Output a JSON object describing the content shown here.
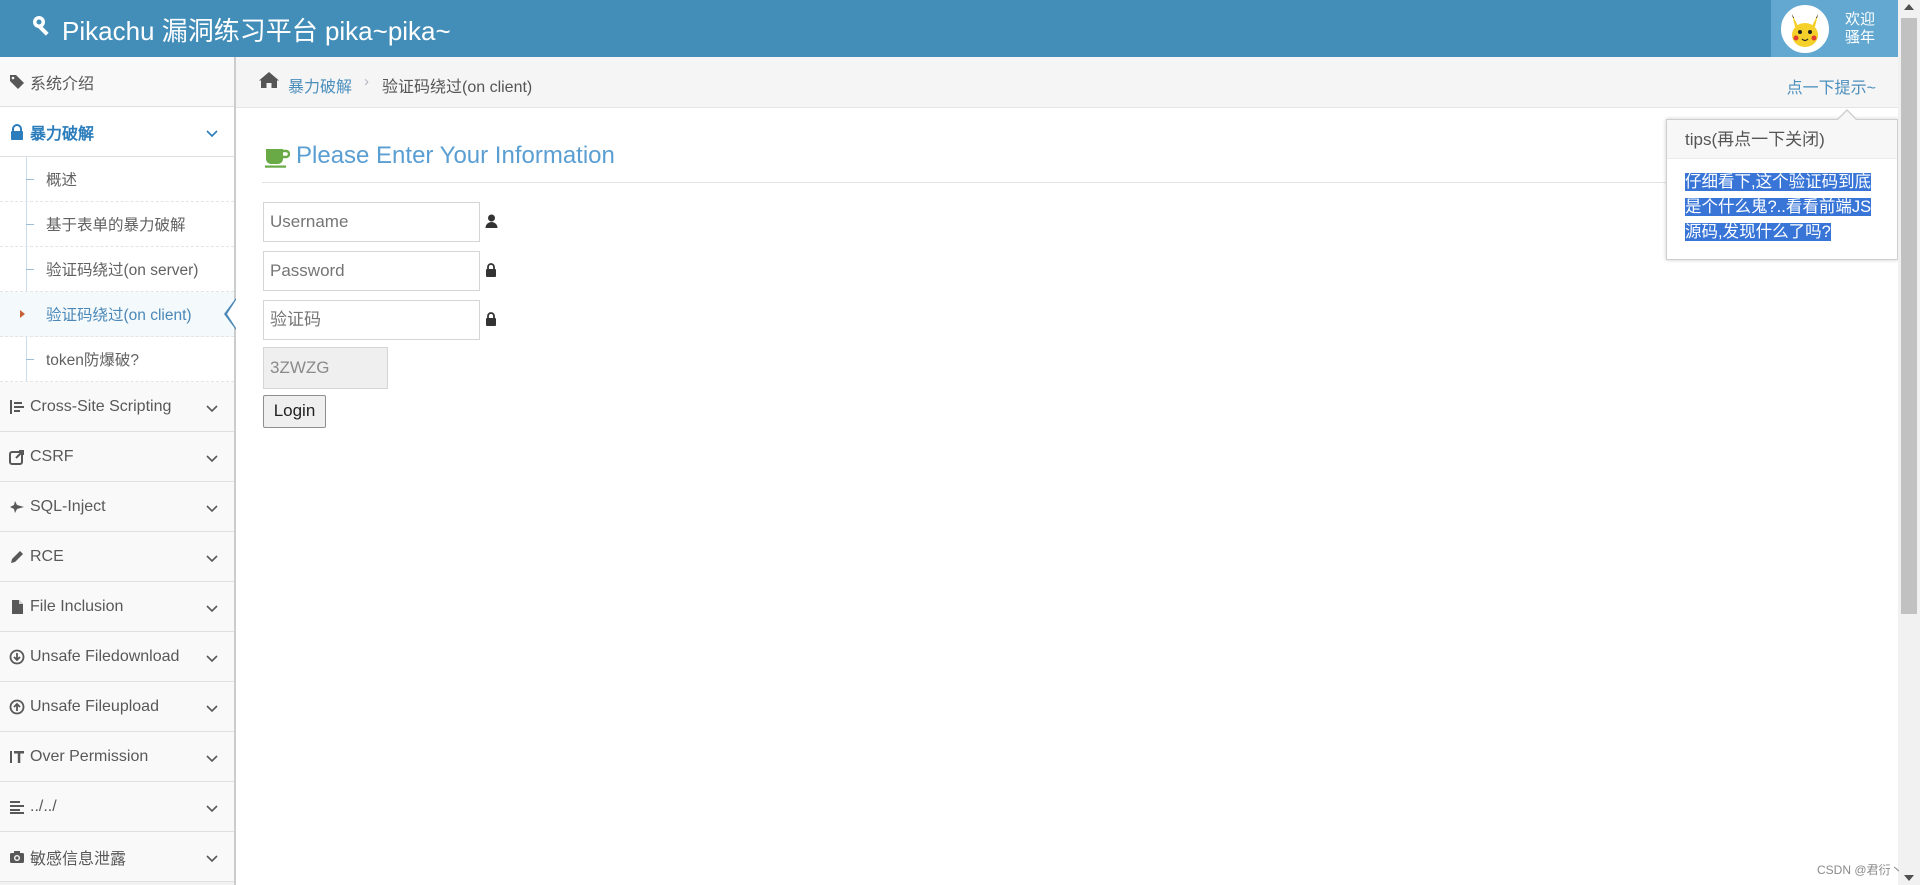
{
  "navbar": {
    "brand": "Pikachu 漏洞练习平台 pika~pika~",
    "welcome_line1": "欢迎",
    "welcome_line2": "骚年",
    "bg_color": "#438eb9"
  },
  "sidebar": {
    "items": [
      {
        "label": "系统介绍",
        "icon": "tags-icon"
      },
      {
        "label": "暴力破解",
        "icon": "lock-icon",
        "active": true
      },
      {
        "label": "Cross-Site Scripting",
        "icon": "sitemap-icon"
      },
      {
        "label": "CSRF",
        "icon": "share-icon"
      },
      {
        "label": "SQL-Inject",
        "icon": "fighter-jet-icon"
      },
      {
        "label": "RCE",
        "icon": "pencil-icon"
      },
      {
        "label": "File Inclusion",
        "icon": "file-icon"
      },
      {
        "label": "Unsafe Filedownload",
        "icon": "download-icon"
      },
      {
        "label": "Unsafe Fileupload",
        "icon": "upload-icon"
      },
      {
        "label": "Over Permission",
        "icon": "text-height-icon"
      },
      {
        "label": "../../",
        "icon": "align-left-icon"
      },
      {
        "label": "敏感信息泄露",
        "icon": "camera-icon"
      }
    ],
    "submenu": [
      {
        "label": "概述"
      },
      {
        "label": "基于表单的暴力破解"
      },
      {
        "label": "验证码绕过(on server)"
      },
      {
        "label": "验证码绕过(on client)",
        "current": true
      },
      {
        "label": "token防爆破?"
      }
    ]
  },
  "breadcrumb": {
    "parent": "暴力破解",
    "separator": "›",
    "current": "验证码绕过(on client)",
    "hint_link": "点一下提示~"
  },
  "main": {
    "heading": "Please Enter Your Information",
    "username_placeholder": "Username",
    "password_placeholder": "Password",
    "captcha_placeholder": "验证码",
    "captcha_value": "3ZWZG",
    "login_label": "Login"
  },
  "popover": {
    "title": "tips(再点一下关闭)",
    "content": "仔细看下,这个验证码到底是个什么鬼?..看看前端JS源码,发现什么了吗?"
  },
  "watermark": "CSDN @君衍丶"
}
